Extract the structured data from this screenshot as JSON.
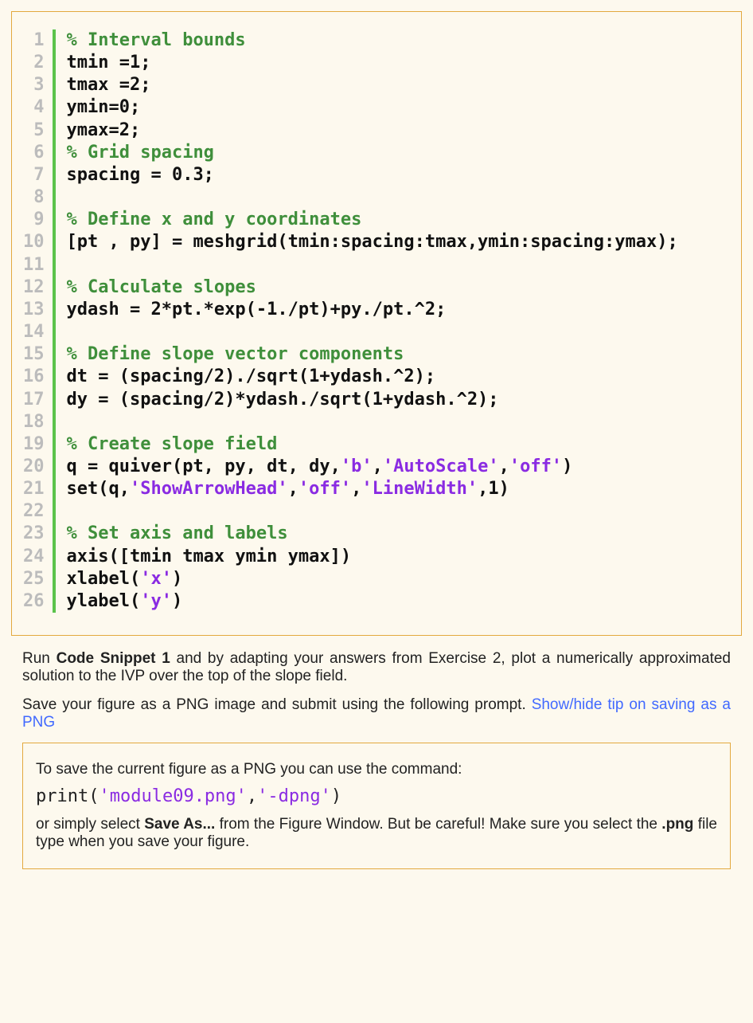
{
  "code": {
    "line_count": 26,
    "lines": [
      [
        {
          "t": "% Interval bounds",
          "cls": "c"
        }
      ],
      [
        {
          "t": "tmin =1;",
          "cls": "n"
        }
      ],
      [
        {
          "t": "tmax =2;",
          "cls": "n"
        }
      ],
      [
        {
          "t": "ymin=0;",
          "cls": "n"
        }
      ],
      [
        {
          "t": "ymax=2;",
          "cls": "n"
        }
      ],
      [
        {
          "t": "% Grid spacing",
          "cls": "c"
        }
      ],
      [
        {
          "t": "spacing = 0.3;",
          "cls": "n"
        }
      ],
      [
        {
          "t": "",
          "cls": "n"
        }
      ],
      [
        {
          "t": "% Define x and y coordinates",
          "cls": "c"
        }
      ],
      [
        {
          "t": "[pt , py] = meshgrid(tmin:spacing:tmax,ymin:spacing:ymax);",
          "cls": "n"
        }
      ],
      [
        {
          "t": "",
          "cls": "n"
        }
      ],
      [
        {
          "t": "% Calculate slopes",
          "cls": "c"
        }
      ],
      [
        {
          "t": "ydash = 2*pt.*exp(-1./pt)+py./pt.^2;",
          "cls": "n"
        }
      ],
      [
        {
          "t": "",
          "cls": "n"
        }
      ],
      [
        {
          "t": "% Define slope vector components",
          "cls": "c"
        }
      ],
      [
        {
          "t": "dt = (spacing/2)./sqrt(1+ydash.^2);",
          "cls": "n"
        }
      ],
      [
        {
          "t": "dy = (spacing/2)*ydash./sqrt(1+ydash.^2);",
          "cls": "n"
        }
      ],
      [
        {
          "t": "",
          "cls": "n"
        }
      ],
      [
        {
          "t": "% Create slope field",
          "cls": "c"
        }
      ],
      [
        {
          "t": "q = quiver(pt, py, dt, dy,",
          "cls": "n"
        },
        {
          "t": "'b'",
          "cls": "s"
        },
        {
          "t": ",",
          "cls": "n"
        },
        {
          "t": "'AutoScale'",
          "cls": "s"
        },
        {
          "t": ",",
          "cls": "n"
        },
        {
          "t": "'off'",
          "cls": "s"
        },
        {
          "t": ")",
          "cls": "n"
        }
      ],
      [
        {
          "t": "set(q,",
          "cls": "n"
        },
        {
          "t": "'ShowArrowHead'",
          "cls": "s"
        },
        {
          "t": ",",
          "cls": "n"
        },
        {
          "t": "'off'",
          "cls": "s"
        },
        {
          "t": ",",
          "cls": "n"
        },
        {
          "t": "'LineWidth'",
          "cls": "s"
        },
        {
          "t": ",1)",
          "cls": "n"
        }
      ],
      [
        {
          "t": "",
          "cls": "n"
        }
      ],
      [
        {
          "t": "% Set axis and labels",
          "cls": "c"
        }
      ],
      [
        {
          "t": "axis([tmin tmax ymin ymax])",
          "cls": "n"
        }
      ],
      [
        {
          "t": "xlabel(",
          "cls": "n"
        },
        {
          "t": "'x'",
          "cls": "s"
        },
        {
          "t": ")",
          "cls": "n"
        }
      ],
      [
        {
          "t": "ylabel(",
          "cls": "n"
        },
        {
          "t": "'y'",
          "cls": "s"
        },
        {
          "t": ")",
          "cls": "n"
        }
      ]
    ]
  },
  "para1": {
    "pre": "Run ",
    "bold": "Code Snippet 1",
    "post": " and by adapting your answers from Exercise 2, plot a numerically approximated solution to the IVP over the top of the slope field."
  },
  "para2": {
    "text": "Save your figure as a PNG image and submit using the following prompt. ",
    "link": "Show/hide tip on saving as a PNG"
  },
  "tip": {
    "intro": "To save the current figure as a PNG you can use the command:",
    "cmd_pre": "print(",
    "cmd_s1": "'module09.png'",
    "cmd_mid": ",",
    "cmd_s2": "'-dpng'",
    "cmd_post": ")",
    "outro_pre": "or simply select ",
    "outro_b1": "Save As...",
    "outro_mid": " from the Figure Window. But be careful! Make sure you select the ",
    "outro_b2": ".png",
    "outro_post": " file type when you save your figure."
  }
}
